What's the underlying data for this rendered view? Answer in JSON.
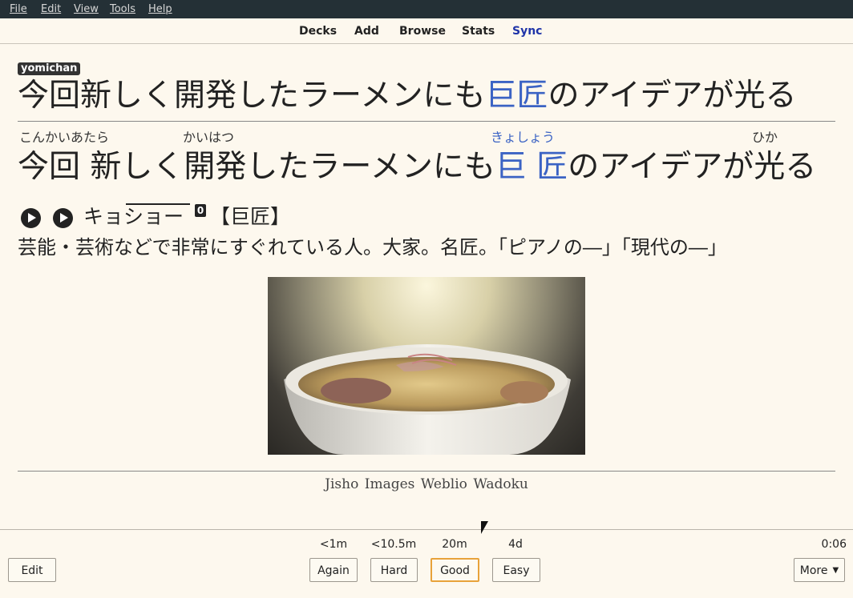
{
  "menu": {
    "items": [
      {
        "label": "File"
      },
      {
        "label": "Edit"
      },
      {
        "label": "View"
      },
      {
        "label": "Tools"
      },
      {
        "label": "Help"
      }
    ]
  },
  "toolbar": {
    "decks": "Decks",
    "add": "Add",
    "browse": "Browse",
    "stats": "Stats",
    "sync": "Sync"
  },
  "card": {
    "tag": "yomichan",
    "front_before": "今回新しく開発したラーメンにも",
    "front_highlight": "巨匠",
    "front_after": "のアイデアが光る",
    "furigana": {
      "f1": "こんかいあたら",
      "f2": "かいはつ",
      "f3": "きょしょう",
      "f4": "ひか"
    },
    "sentence_before": "今回 新しく開発したラーメンにも",
    "sentence_highlight": "巨 匠",
    "sentence_after": "のアイデアが光る",
    "reading": "キョショー",
    "pitch": "0",
    "kanji": "【巨匠】",
    "definition": "芸能・芸術などで非常にすぐれている人。大家。名匠。「ピアノの―」「現代の―」",
    "links": {
      "jisho": "Jisho",
      "images": "Images",
      "weblio": "Weblio",
      "wadoku": "Wadoku"
    }
  },
  "review": {
    "intervals": {
      "again": "<1m",
      "hard": "<10.5m",
      "good": "20m",
      "easy": "4d"
    },
    "timer": "0:06",
    "edit": "Edit",
    "again": "Again",
    "hard": "Hard",
    "good": "Good",
    "easy": "Easy",
    "more": "More"
  },
  "colors": {
    "highlight": "#3b63c4",
    "sync": "#1f34a8",
    "menubar": "#243036",
    "background": "#fdf8ee",
    "good_border": "#e8a23a"
  }
}
